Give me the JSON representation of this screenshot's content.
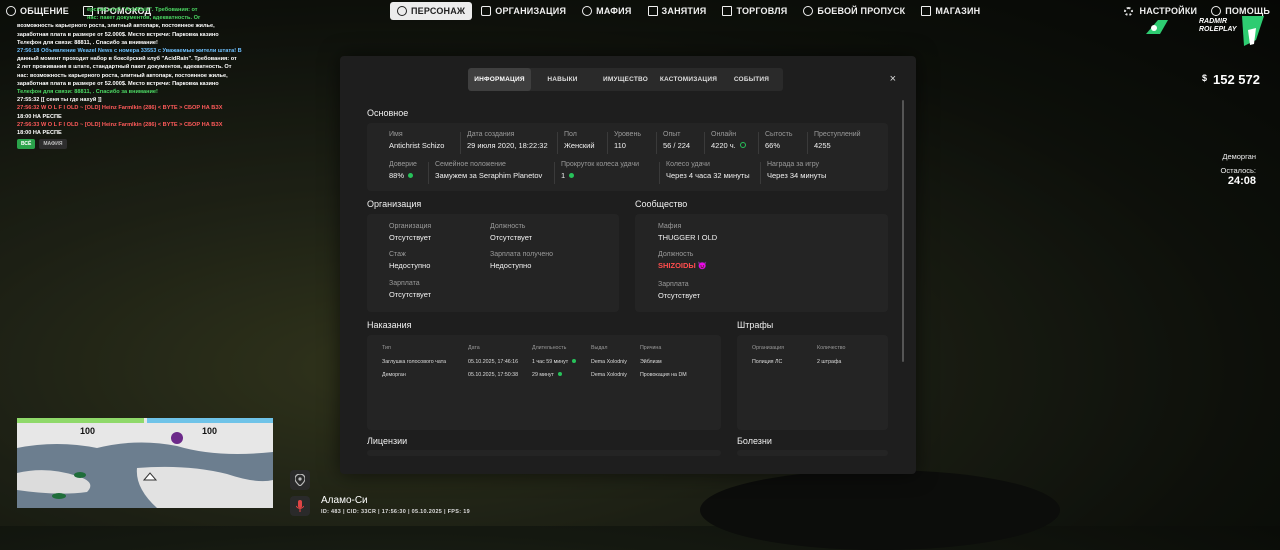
{
  "topbar": {
    "left": [
      {
        "label": "ОБЩЕНИЕ",
        "icon": "chat-icon"
      },
      {
        "label": "ПРОМОКОД",
        "icon": "gift-icon"
      }
    ],
    "nav": [
      {
        "label": "ПЕРСОНАЖ",
        "icon": "person-icon",
        "active": true
      },
      {
        "label": "ОРГАНИЗАЦИЯ",
        "icon": "organization-icon"
      },
      {
        "label": "МАФИЯ",
        "icon": "mafia-icon"
      },
      {
        "label": "ЗАНЯТИЯ",
        "icon": "calendar-icon"
      },
      {
        "label": "ТОРГОВЛЯ",
        "icon": "trade-icon"
      },
      {
        "label": "БОЕВОЙ ПРОПУСК",
        "icon": "battlepass-icon"
      },
      {
        "label": "МАГАЗИН",
        "icon": "shop-icon"
      }
    ],
    "right": [
      {
        "label": "НАСТРОЙКИ",
        "icon": "gear-icon"
      },
      {
        "label": "ПОМОЩЬ",
        "icon": "help-icon"
      }
    ]
  },
  "chat": {
    "lines": [
      "ёрский клуб \"AcidRain\". Требования: от",
      "нас: пакет документов, адекватность. Ог",
      "возможность карьерного роста, элитный автопарк, постоянное жилье,",
      "заработная плата в размере от 52.000$. Место встречи: Парковка казино",
      "Телефон для связи: 88811, . Спасибо за внимание!",
      "27:56:18 Объявление Weazel News с номера 33553 с Уважаемые жители штата! В",
      "данный момент проходит набор в боксёрский клуб \"AcidRain\". Требования: от",
      "2 лет проживания в штате, стандартный пакет документов, адекватность. От",
      "нас: возможность карьерного роста, элитный автопарк, постоянное жилье,",
      "заработная плата в размере от 52.000$. Место встречи: Парковка казино",
      "Телефон для связи: 88811, . Спасибо за внимание!",
      "27:55:32 [[ сеня ты где нахуй ]]",
      "27:56:32 W O L F I OLD ~ [OLD] Heinz Farmlkin (286) < BYTE > СБОР НА ВЗХ",
      "18:00 НА РЕСПЕ",
      "27:56:33 W O L F I OLD ~ [OLD] Heinz Farmlkin (286) < BYTE > СБОР НА ВЗХ",
      "18:00 НА РЕСПЕ"
    ],
    "tabs": [
      "ВСЁ",
      "МАФИЯ"
    ]
  },
  "hud": {
    "money_symbol": "$",
    "money": "152 572",
    "logo_line1": "RADMIR",
    "logo_line2": "ROLEPLAY",
    "event_title": "Деморган",
    "event_left_label": "Осталось:",
    "event_time": "24:08",
    "health": "100",
    "armor": "100",
    "location": "Аламо-Си",
    "player_info": "ID: 483 | CID: 33CR | 17:56:30 | 05.10.2025 | FPS: 19"
  },
  "modal": {
    "tabs": [
      "ИНФОРМАЦИЯ",
      "НАВЫКИ",
      "ИМУЩЕСТВО",
      "КАСТОМИЗАЦИЯ",
      "СОБЫТИЯ"
    ],
    "active_tab": 0,
    "close": "×",
    "basic": {
      "title": "Основное",
      "row1": [
        {
          "label": "Имя",
          "value": "Antichrist Schizo"
        },
        {
          "label": "Дата создания",
          "value": "29 июля 2020, 18:22:32"
        },
        {
          "label": "Пол",
          "value": "Женский"
        },
        {
          "label": "Уровень",
          "value": "110"
        },
        {
          "label": "Опыт",
          "value": "56 / 224"
        },
        {
          "label": "Онлайн",
          "value": "4220 ч."
        },
        {
          "label": "Сытость",
          "value": "66%"
        },
        {
          "label": "Преступлений",
          "value": "4255"
        }
      ],
      "row2": [
        {
          "label": "Доверие",
          "value": "88%"
        },
        {
          "label": "Семейное положение",
          "value": "Замужем за Seraphim Planetov"
        },
        {
          "label": "Прокруток колеса удачи",
          "value": "1"
        },
        {
          "label": "Колесо удачи",
          "value": "Через 4 часа 32 минуты"
        },
        {
          "label": "Награда за игру",
          "value": "Через 34 минуты"
        }
      ]
    },
    "organization": {
      "title": "Организация",
      "fields": [
        {
          "label": "Организация",
          "value": "Отсутствует"
        },
        {
          "label": "Должность",
          "value": "Отсутствует"
        },
        {
          "label": "Стаж",
          "value": "Недоступно"
        },
        {
          "label": "Зарплата получено",
          "value": "Недоступно"
        },
        {
          "label": "Зарплата",
          "value": "Отсутствует"
        }
      ]
    },
    "community": {
      "title": "Сообщество",
      "fields": [
        {
          "label": "Мафия",
          "value": "THUGGER I OLD"
        },
        {
          "label": "Должность",
          "value": "SHIZOIDЫ 😈"
        },
        {
          "label": "Зарплата",
          "value": "Отсутствует"
        }
      ]
    },
    "punishments": {
      "title": "Наказания",
      "headers": [
        "Тип",
        "Дата",
        "Длительность",
        "Выдал",
        "Причина"
      ],
      "rows": [
        [
          "Заглушка голосового чата",
          "05.10.2025, 17:46:16",
          "1 час 59 минут",
          "Dema Xolodniy",
          "Эйблизм"
        ],
        [
          "Деморган",
          "05.10.2025, 17:50:38",
          "29 минут",
          "Dema Xolodniy",
          "Провокация на DM"
        ]
      ]
    },
    "fines": {
      "title": "Штрафы",
      "headers": [
        "Организация",
        "Количество"
      ],
      "rows": [
        [
          "Полиция ЛС",
          "2 штрафа"
        ]
      ]
    },
    "licenses_title": "Лицензии",
    "diseases_title": "Болезни"
  }
}
